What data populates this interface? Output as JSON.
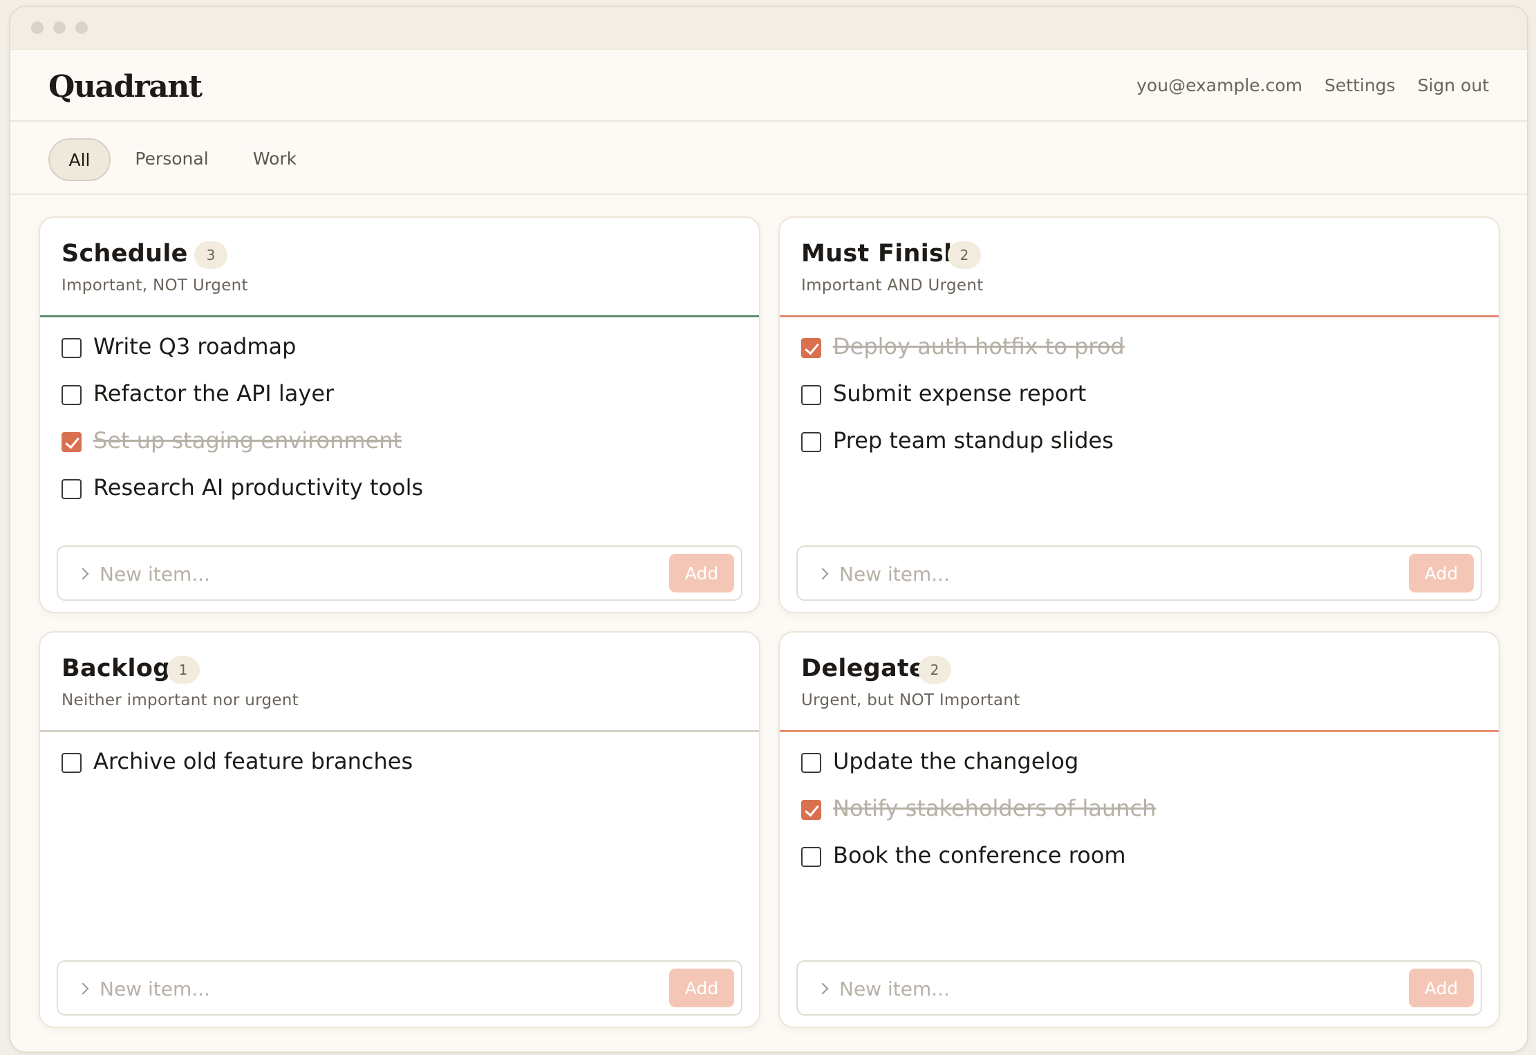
{
  "app": {
    "name": "Quadrant",
    "user_email": "you@example.com",
    "settings_label": "Settings",
    "signout_label": "Sign out"
  },
  "tabs": [
    {
      "label": "All",
      "active": true
    },
    {
      "label": "Personal",
      "active": false
    },
    {
      "label": "Work",
      "active": false
    }
  ],
  "quadrants": {
    "schedule": {
      "title": "Schedule",
      "count": "3",
      "subtitle": "Important, NOT Urgent",
      "accent": "#5e8c6e",
      "items": [
        {
          "text": "Write Q3 roadmap",
          "done": false
        },
        {
          "text": "Refactor the API layer",
          "done": false
        },
        {
          "text": "Set up staging environment",
          "done": true
        },
        {
          "text": "Research AI productivity tools",
          "done": false
        }
      ],
      "placeholder": "New item...",
      "add_label": "Add"
    },
    "must_finish": {
      "title": "Must Finish",
      "count": "2",
      "subtitle": "Important AND Urgent",
      "accent": "#e08a6e",
      "items": [
        {
          "text": "Deploy auth hotfix to prod",
          "done": true
        },
        {
          "text": "Submit expense report",
          "done": false
        },
        {
          "text": "Prep team standup slides",
          "done": false
        }
      ],
      "placeholder": "New item...",
      "add_label": "Add"
    },
    "backlog": {
      "title": "Backlog",
      "count": "1",
      "subtitle": "Neither important nor urgent",
      "accent": "#d7d2c9",
      "items": [
        {
          "text": "Archive old feature branches",
          "done": false
        }
      ],
      "placeholder": "New item...",
      "add_label": "Add"
    },
    "delegate": {
      "title": "Delegate",
      "count": "2",
      "subtitle": "Urgent, but NOT Important",
      "accent": "#e88f70",
      "items": [
        {
          "text": "Update the changelog",
          "done": false
        },
        {
          "text": "Notify stakeholders of launch",
          "done": true
        },
        {
          "text": "Book the conference room",
          "done": false
        }
      ],
      "placeholder": "New item...",
      "add_label": "Add"
    }
  }
}
